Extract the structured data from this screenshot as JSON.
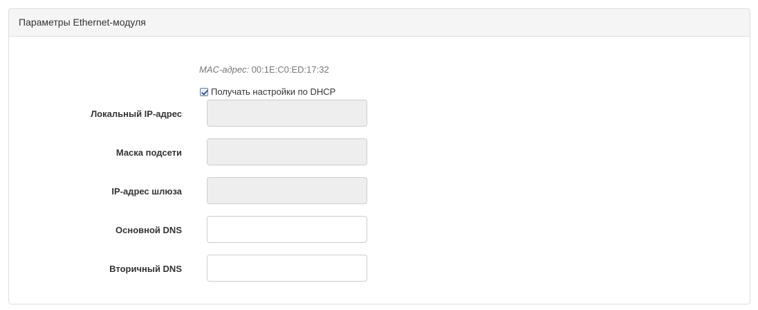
{
  "panel": {
    "title": "Параметры Ethernet-модуля"
  },
  "mac": {
    "label": "MAC-адрес:",
    "value": "00:1E:C0:ED:17:32"
  },
  "dhcp": {
    "label": "Получать настройки по DHCP",
    "checked": true
  },
  "fields": [
    {
      "label": "Локальный IP-адрес",
      "value": "",
      "disabled": true
    },
    {
      "label": "Маска подсети",
      "value": "",
      "disabled": true
    },
    {
      "label": "IP-адрес шлюза",
      "value": "",
      "disabled": true
    },
    {
      "label": "Основной DNS",
      "value": "",
      "disabled": false
    },
    {
      "label": "Вторичный DNS",
      "value": "",
      "disabled": false
    }
  ],
  "colors": {
    "heading_bg": "#f5f5f5",
    "border": "#dddddd",
    "disabled_bg": "#eeeeee",
    "muted_text": "#777777"
  }
}
